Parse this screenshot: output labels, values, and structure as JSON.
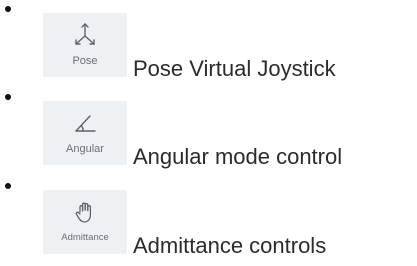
{
  "items": [
    {
      "icon": "pose-joystick-icon",
      "tile_label": "Pose",
      "text": "Pose Virtual Joystick"
    },
    {
      "icon": "angle-icon",
      "tile_label": "Angular",
      "text": "Angular mode control"
    },
    {
      "icon": "hand-icon",
      "tile_label": "Admittance",
      "text": "Admittance controls"
    }
  ],
  "colors": {
    "tile_background": "#eef1f4",
    "tile_label": "#6b6f75",
    "icon_stroke": "#5f6368",
    "text": "#2b2b2b"
  }
}
